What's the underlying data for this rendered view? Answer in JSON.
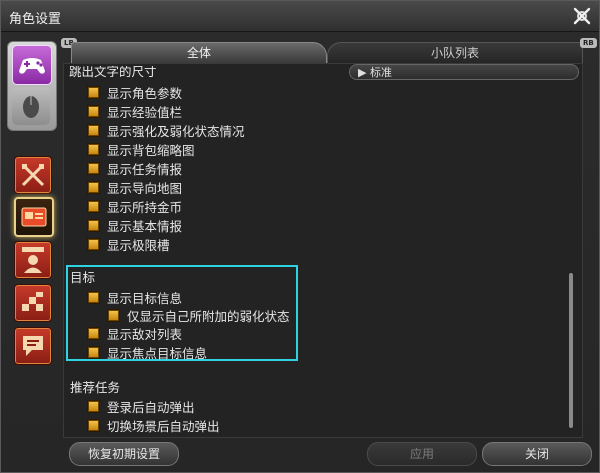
{
  "window": {
    "title": "角色设置"
  },
  "tabs": {
    "left_badge": "LB",
    "right_badge": "RB",
    "all": "全体",
    "party": "小队列表"
  },
  "dropdown": {
    "value": "标准"
  },
  "section_top": {
    "partial_heading": "跳出文字的尺寸",
    "items": [
      "显示角色参数",
      "显示经验值栏",
      "显示强化及弱化状态情况",
      "显示背包缩略图",
      "显示任务情报",
      "显示导向地图",
      "显示所持金币",
      "显示基本情报",
      "显示极限槽"
    ]
  },
  "section_target": {
    "heading": "目标",
    "items": [
      "显示目标信息",
      "仅显示自己所附加的弱化状态",
      "显示敌对列表",
      "显示焦点目标信息"
    ]
  },
  "section_quest": {
    "heading": "推荐任务",
    "items": [
      "登录后自动弹出",
      "切换场景后自动弹出"
    ]
  },
  "buttons": {
    "reset": "恢复初期设置",
    "apply": "应用",
    "close": "关闭"
  },
  "colors": {
    "highlight": "#2fd3e0",
    "checkbox": "#f3c24a"
  }
}
